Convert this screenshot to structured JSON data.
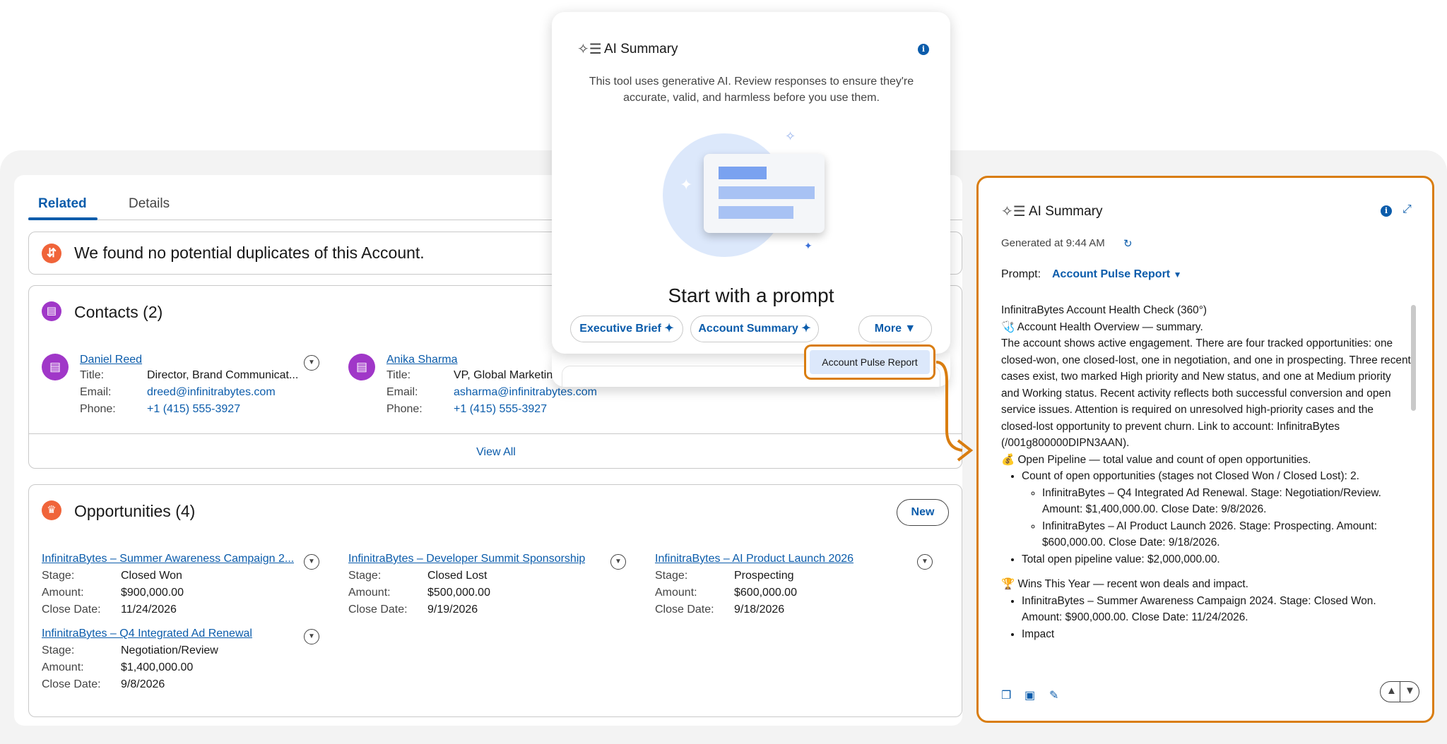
{
  "record": {
    "tabs": {
      "related": "Related",
      "details": "Details"
    },
    "duplicates": {
      "message": "We found no potential duplicates of this Account."
    },
    "contacts": {
      "title": "Contacts (2)",
      "view_all": "View All",
      "items": [
        {
          "name": "Daniel Reed",
          "title_label": "Title:",
          "title": "Director, Brand Communicat...",
          "email_label": "Email:",
          "email": "dreed@infinitrabytes.com",
          "phone_label": "Phone:",
          "phone": "+1 (415) 555-3927"
        },
        {
          "name": "Anika Sharma",
          "title_label": "Title:",
          "title": "VP, Global Marketing",
          "email_label": "Email:",
          "email": "asharma@infinitrabytes.com",
          "phone_label": "Phone:",
          "phone": "+1 (415) 555-3927"
        }
      ]
    },
    "opportunities": {
      "title": "Opportunities (4)",
      "new_label": "New",
      "items": [
        {
          "name": "InfinitraBytes – Summer Awareness Campaign 2...",
          "stage_label": "Stage:",
          "stage": "Closed Won",
          "amount_label": "Amount:",
          "amount": "$900,000.00",
          "close_label": "Close Date:",
          "close": "11/24/2026"
        },
        {
          "name": "InfinitraBytes – Developer Summit Sponsorship",
          "stage_label": "Stage:",
          "stage": "Closed Lost",
          "amount_label": "Amount:",
          "amount": "$500,000.00",
          "close_label": "Close Date:",
          "close": "9/19/2026"
        },
        {
          "name": "InfinitraBytes – AI Product Launch 2026",
          "stage_label": "Stage:",
          "stage": "Prospecting",
          "amount_label": "Amount:",
          "amount": "$600,000.00",
          "close_label": "Close Date:",
          "close": "9/18/2026"
        },
        {
          "name": "InfinitraBytes – Q4 Integrated Ad Renewal",
          "stage_label": "Stage:",
          "stage": "Negotiation/Review",
          "amount_label": "Amount:",
          "amount": "$1,400,000.00",
          "close_label": "Close Date:",
          "close": "9/8/2026"
        }
      ]
    }
  },
  "popup": {
    "title": "AI Summary",
    "disclaimer": "This tool uses generative AI. Review responses to ensure they're accurate, valid, and harmless before you use them.",
    "heading": "Start with a prompt",
    "chips": {
      "executive_brief": "Executive Brief",
      "account_summary": "Account Summary",
      "more": "More"
    },
    "menu_item": "Account Pulse Report"
  },
  "summary": {
    "title": "AI Summary",
    "generated": "Generated at 9:44 AM",
    "prompt_label": "Prompt:",
    "prompt_value": "Account Pulse Report",
    "heading_line": "InfinitraBytes Account Health Check (360°)",
    "overview_heading": "🩺 Account Health Overview — summary.",
    "overview_body": "The account shows active engagement. There are four tracked opportunities: one closed-won, one closed-lost, one in negotiation, and one in prospecting. Three recent cases exist, two marked High priority and New status, and one at Medium priority and Working status. Recent activity reflects both successful conversion and open service issues. Attention is required on unresolved high-priority cases and the closed-lost opportunity to prevent churn. Link to account: InfinitraBytes (/001g800000DIPN3AAN).",
    "pipeline_heading": "💰 Open Pipeline — total value and count of open opportunities.",
    "pipeline_count": "Count of open opportunities (stages not Closed Won / Closed Lost): 2.",
    "pipeline_item1": "InfinitraBytes – Q4 Integrated Ad Renewal. Stage: Negotiation/Review. Amount: $1,400,000.00. Close Date: 9/8/2026.",
    "pipeline_item2": "InfinitraBytes – AI Product Launch 2026. Stage: Prospecting. Amount: $600,000.00. Close Date: 9/18/2026.",
    "pipeline_total": "Total open pipeline value: $2,000,000.00.",
    "wins_heading": "🏆 Wins This Year — recent won deals and impact.",
    "wins_item1": "InfinitraBytes – Summer Awareness Campaign 2024. Stage: Closed Won. Amount: $900,000.00. Close Date: 11/24/2026.",
    "wins_item2": "Impact"
  },
  "icons": {
    "duplicate": "duplicate-check-icon",
    "contacts": "contact-card-icon",
    "opportunities": "crown-icon",
    "ai": "sparkle-list-icon",
    "info": "info-icon",
    "expand": "expand-icon",
    "refresh": "refresh-sparkle-icon",
    "copy": "copy-icon",
    "save": "save-icon",
    "edit": "pencil-icon",
    "thumbs_up": "thumbs-up-icon",
    "thumbs_down": "thumbs-down-icon"
  },
  "colors": {
    "accent_blue": "#0b5cab",
    "highlight_orange": "#d97d10",
    "contact_purple": "#a037c8",
    "opportunity_orange": "#f0643a"
  }
}
